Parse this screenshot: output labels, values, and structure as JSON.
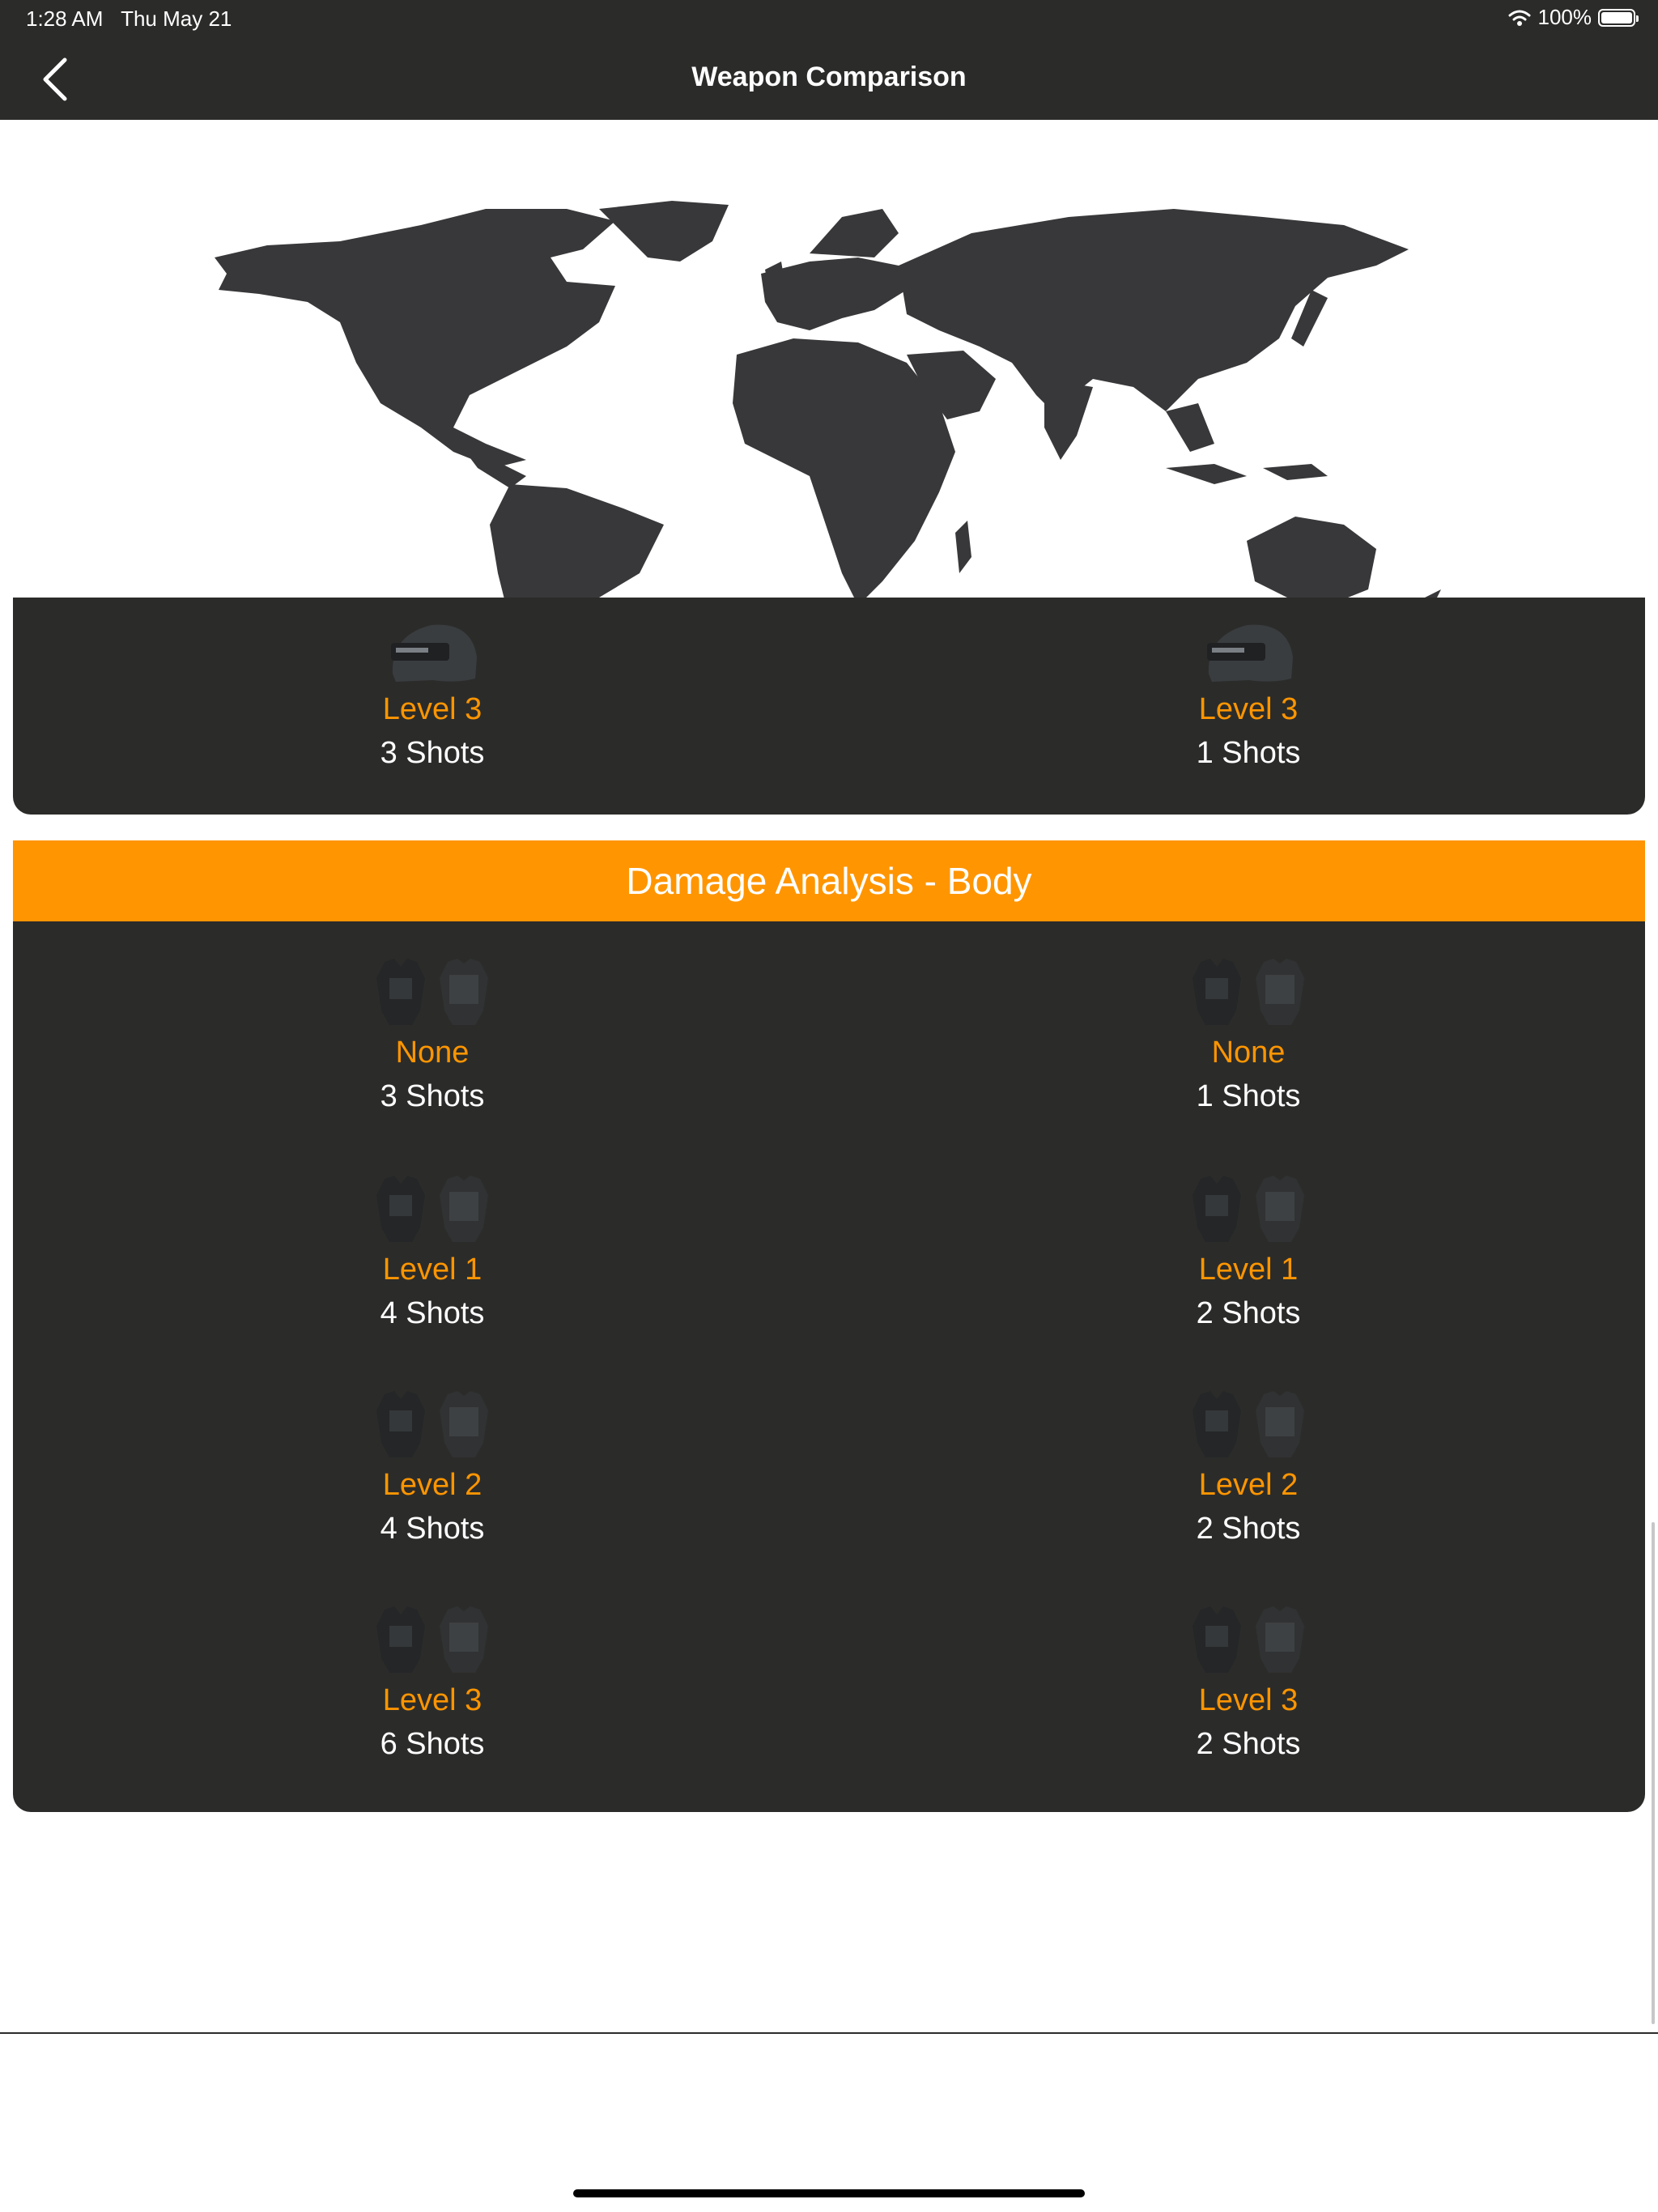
{
  "status_bar": {
    "time": "1:28 AM",
    "date": "Thu May 21",
    "battery": "100%"
  },
  "nav": {
    "title": "Weapon Comparison",
    "back_icon": "chevron-left-icon"
  },
  "map": {
    "icon": "world-map-icon",
    "color": "#38383a"
  },
  "helmet_row": {
    "left": {
      "level": "Level 3",
      "shots": "3 Shots"
    },
    "right": {
      "level": "Level 3",
      "shots": "1 Shots"
    }
  },
  "body_section": {
    "title": "Damage Analysis - Body",
    "left": [
      {
        "level": "None",
        "shots": "3 Shots"
      },
      {
        "level": "Level 1",
        "shots": "4 Shots"
      },
      {
        "level": "Level 2",
        "shots": "4 Shots"
      },
      {
        "level": "Level 3",
        "shots": "6 Shots"
      }
    ],
    "right": [
      {
        "level": "None",
        "shots": "1 Shots"
      },
      {
        "level": "Level 1",
        "shots": "2 Shots"
      },
      {
        "level": "Level 2",
        "shots": "2 Shots"
      },
      {
        "level": "Level 3",
        "shots": "2 Shots"
      }
    ]
  },
  "colors": {
    "accent": "#ff9500",
    "card": "#2b2c2a",
    "text": "#ffffff"
  }
}
